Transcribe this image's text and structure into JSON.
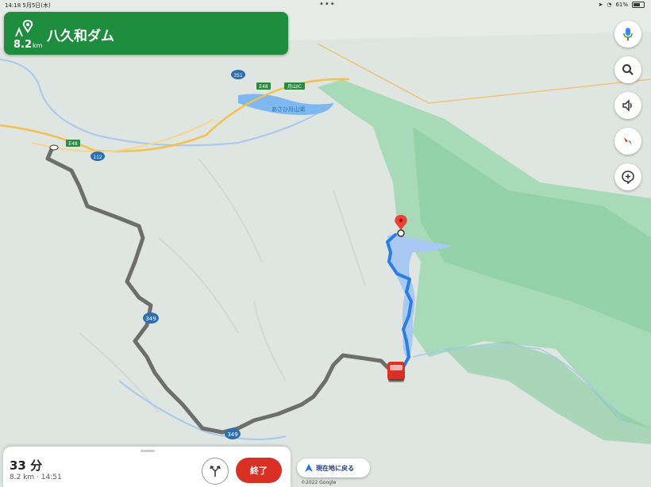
{
  "status_bar": {
    "time_date": "14:18  5月5日(木)",
    "dots": "•••",
    "battery": "61%"
  },
  "navigation": {
    "destination": "八久和ダム",
    "distance_value": "8.2",
    "distance_unit": "km"
  },
  "map": {
    "labels": {
      "lake": "あさひ月山湖",
      "road_349_a": "349",
      "road_349_b": "349",
      "road_112": "112",
      "road_351": "351",
      "e48_a": "E48",
      "e48_b": "E48",
      "ic": "月山IC"
    },
    "colors": {
      "forest": "#8fd3a8",
      "route_traveled": "#6e6e6e",
      "water": "#7fb8f0",
      "pin": "#ea4335"
    }
  },
  "side_buttons": [
    {
      "icon": "microphone-icon"
    },
    {
      "icon": "search-icon"
    },
    {
      "icon": "speaker-icon"
    },
    {
      "icon": "compass-icon"
    },
    {
      "icon": "report-icon"
    }
  ],
  "trip": {
    "eta": "33 分",
    "details": "8.2 km · 14:51",
    "end_label": "終了"
  },
  "recenter_label": "現在地に戻る",
  "copyright": "©2022 Google"
}
